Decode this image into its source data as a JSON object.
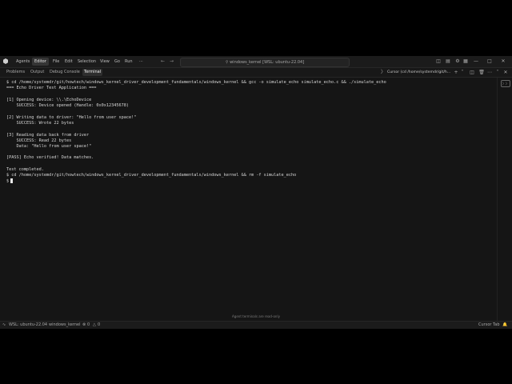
{
  "titlebar": {
    "menu": [
      "Agents",
      "Editor",
      "File",
      "Edit",
      "Selection",
      "View",
      "Go",
      "Run",
      "⋯"
    ],
    "active_menu": "Editor",
    "search_text": "windows_kernel [WSL: ubuntu-22.04]"
  },
  "panel": {
    "tabs": [
      "Problems",
      "Output",
      "Debug Console",
      "Terminal"
    ],
    "active_tab": "Terminal",
    "terminal_name": "Cursor (cd /home/systemdr/git/h..."
  },
  "terminal": {
    "lines": [
      "$ cd /home/systemdr/git/howtech/windows_kernel_driver_development_fundamentals/windows_kernel && gcc -o simulate_echo simulate_echo.c && ./simulate_echo",
      "=== Echo Driver Test Application ===",
      "",
      "[1] Opening device: \\\\.\\EchoDevice",
      "    SUCCESS: Device opened (Handle: 0x0x12345678)",
      "",
      "[2] Writing data to driver: \"Hello from user space!\"",
      "    SUCCESS: Wrote 22 bytes",
      "",
      "[3] Reading data back from driver",
      "    SUCCESS: Read 22 bytes",
      "    Data: \"Hello from user space!\"",
      "",
      "[PASS] Echo verified! Data matches.",
      "",
      "Test completed.",
      "$ cd /home/systemdr/git/howtech/windows_kernel_driver_development_fundamentals/windows_kernel && rm -f simulate_echo"
    ],
    "prompt": "$",
    "note": "Agent terminals are read-only"
  },
  "statusbar": {
    "remote": "WSL: ubuntu-22.04",
    "folder": "windows_kernel",
    "errors": "0",
    "warnings": "0",
    "right": "Cursor Tab"
  }
}
